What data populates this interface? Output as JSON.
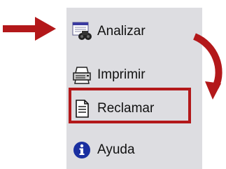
{
  "menu": {
    "items": [
      {
        "label": "Analizar",
        "icon": "binoculars-icon"
      },
      {
        "label": "Imprimir",
        "icon": "printer-icon"
      },
      {
        "label": "Reclamar",
        "icon": "document-icon"
      },
      {
        "label": "Ayuda",
        "icon": "info-icon"
      }
    ],
    "highlighted_item": "Reclamar"
  },
  "annotations": {
    "arrow_color": "#b3181a",
    "highlight_color": "#b3181a"
  },
  "colors": {
    "panel_background": "#dddde1",
    "text": "#111111",
    "info_blue": "#1a2fa0"
  }
}
